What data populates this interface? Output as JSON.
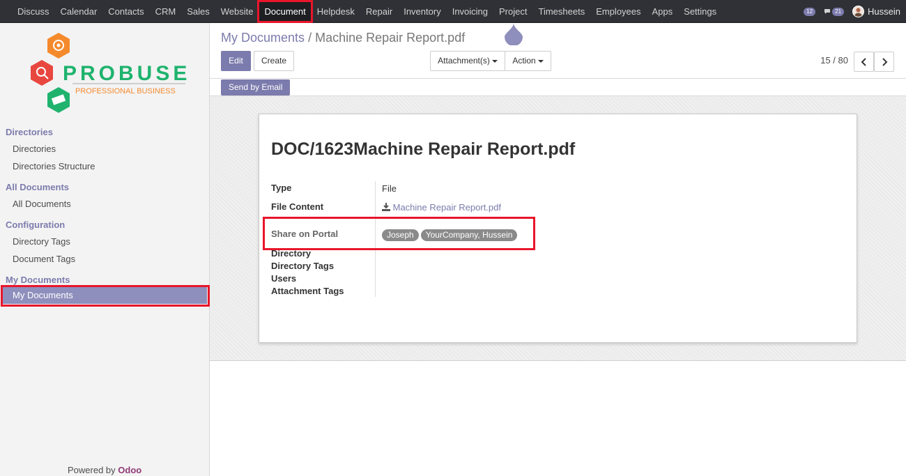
{
  "topbar": {
    "menu": [
      "Discuss",
      "Calendar",
      "Contacts",
      "CRM",
      "Sales",
      "Website",
      "Document",
      "Helpdesk",
      "Repair",
      "Inventory",
      "Invoicing",
      "Project",
      "Timesheets",
      "Employees",
      "Apps",
      "Settings"
    ],
    "active": "Document",
    "activity_count": "12",
    "message_count": "21",
    "user_name": "Hussein"
  },
  "logo": {
    "brand": "PROBUSE",
    "tagline": "PROFESSIONAL BUSINESS"
  },
  "sidebar": {
    "sections": [
      {
        "title": "Directories",
        "items": [
          "Directories",
          "Directories Structure"
        ]
      },
      {
        "title": "All Documents",
        "items": [
          "All Documents"
        ]
      },
      {
        "title": "Configuration",
        "items": [
          "Directory Tags",
          "Document Tags"
        ]
      },
      {
        "title": "My Documents",
        "items": [
          "My Documents"
        ]
      }
    ],
    "powered_prefix": "Powered by",
    "powered_brand": "Odoo"
  },
  "breadcrumb": {
    "parent": "My Documents",
    "separator": "/",
    "current": "Machine Repair Report.pdf"
  },
  "buttons": {
    "edit": "Edit",
    "create": "Create",
    "attachments": "Attachment(s)",
    "action": "Action",
    "send_email": "Send by Email"
  },
  "pager": {
    "value": "15 / 80"
  },
  "record": {
    "title": "DOC/1623Machine Repair Report.pdf",
    "fields": {
      "type_label": "Type",
      "type_value": "File",
      "file_content_label": "File Content",
      "file_content_value": "Machine Repair Report.pdf",
      "share_label": "Share on Portal",
      "share_tags": [
        "Joseph",
        "YourCompany, Hussein"
      ],
      "directory_label": "Directory",
      "directory_tags_label": "Directory Tags",
      "users_label": "Users",
      "attachment_tags_label": "Attachment Tags"
    }
  },
  "colors": {
    "accent": "#7c7bad",
    "highlight": "#e8162b",
    "navbar": "#2f3136"
  }
}
